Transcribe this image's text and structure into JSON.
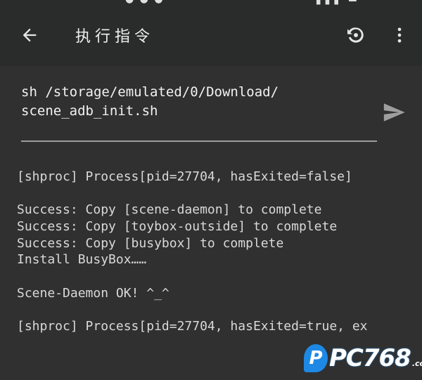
{
  "toolbar": {
    "back_icon": "arrow-left-icon",
    "title": "执行指令",
    "history_icon": "history-icon",
    "more_icon": "more-vert-icon"
  },
  "command": {
    "value": "sh /storage/emulated/0/Download/\nscene_adb_init.sh",
    "send_icon": "send-icon"
  },
  "output": {
    "lines": [
      "[shproc] Process[pid=27704, hasExited=false]",
      "",
      "Success: Copy [scene-daemon] to complete",
      "Success: Copy [toybox-outside] to complete",
      "Success: Copy [busybox] to complete",
      "Install BusyBox……",
      "",
      "Scene-Daemon OK! ^_^",
      "",
      "[shproc] Process[pid=27704, hasExited=true, ex"
    ]
  },
  "watermark": {
    "logo_letter": "P",
    "text": "PC768",
    "suffix": ".com"
  },
  "colors": {
    "background": "#303030",
    "toolbar": "#2a2b2b",
    "accent": "#1e88e5"
  }
}
